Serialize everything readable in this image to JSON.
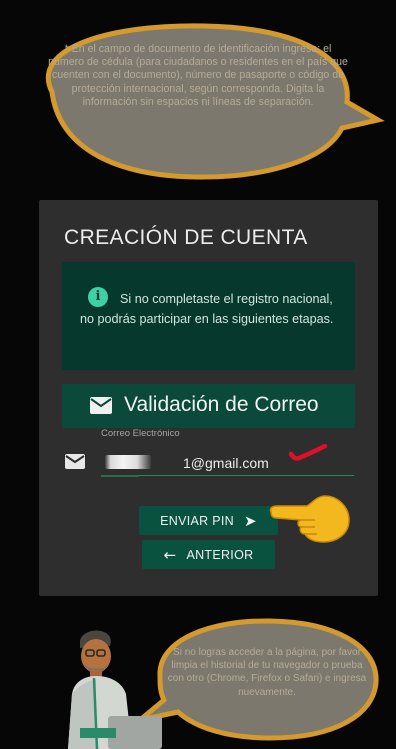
{
  "tip_top": "* En el campo de documento de identificación ingresa: el número de cédula (para ciudadanos o residentes en el país que cuenten con el documento), número de pasaporte o código de protección internacional, según corresponda. Digita la información sin espacios ni líneas de separación.",
  "card": {
    "title": "CREACIÓN DE CUENTA",
    "notice": "Si no completaste el registro nacional, no podrás participar en las siguientes etapas.",
    "validation_title": "Validación de Correo",
    "email_label": "Correo Electrónico",
    "email_value": "1@gmail.com",
    "send_pin_label": "ENVIAR PIN",
    "back_label": "ANTERIOR"
  },
  "tip_bottom": "Si no logras acceder a la página, por favor limpia el historial de tu navegador o prueba con otro (Chrome, Firefox o Safari) e ingresa nuevamente.",
  "icons": [
    "info-icon",
    "mail-icon",
    "arrow-right-icon",
    "arrow-left-icon",
    "pointing-hand-icon",
    "check-mark-icon"
  ],
  "colors": {
    "background": "#060606",
    "card": "#2e2e2e",
    "notice_bg": "#07382d",
    "accent": "#0a5240",
    "bubble_fill": "#7d786d",
    "bubble_border": "#d49a2d",
    "check_mark": "#e0102d"
  }
}
